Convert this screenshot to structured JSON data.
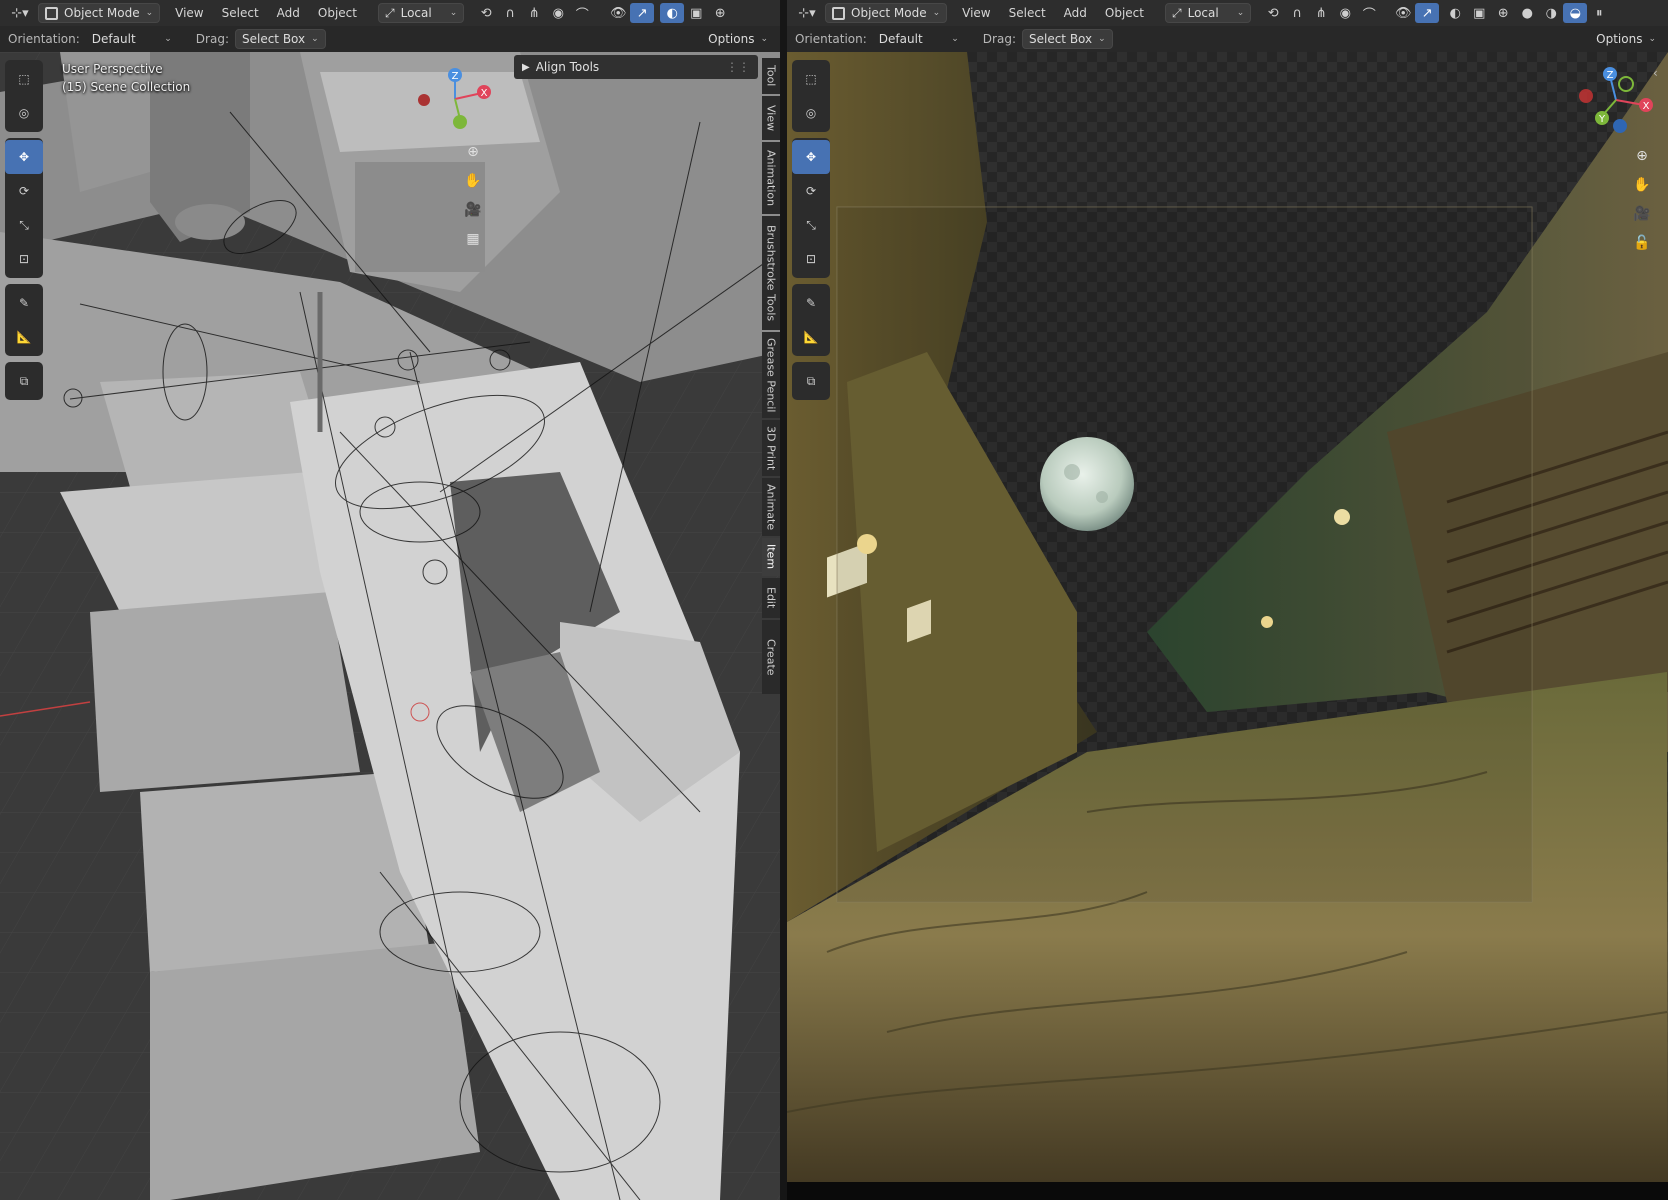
{
  "left": {
    "header": {
      "mode": "Object Mode",
      "menus": [
        "View",
        "Select",
        "Add",
        "Object"
      ],
      "transform_orientation": "Local"
    },
    "tool_header": {
      "orientation_label": "Orientation:",
      "orientation_value": "Default",
      "drag_label": "Drag:",
      "drag_value": "Select Box",
      "options": "Options"
    },
    "overlay": {
      "view_name": "User Perspective",
      "collection": "(15) Scene Collection"
    },
    "align_panel_title": "Align Tools",
    "sidebar_tabs": [
      "Tool",
      "View",
      "Animation",
      "Brushstroke Tools",
      "Grease Pencil",
      "3D Print",
      "Animate",
      "Item",
      "Edit",
      "Create"
    ],
    "active_tab": "Item",
    "gizmo_axes": [
      "Z",
      "X"
    ]
  },
  "right": {
    "header": {
      "mode": "Object Mode",
      "menus": [
        "View",
        "Select",
        "Add",
        "Object"
      ],
      "transform_orientation": "Local"
    },
    "tool_header": {
      "orientation_label": "Orientation:",
      "orientation_value": "Default",
      "drag_label": "Drag:",
      "drag_value": "Select Box",
      "options": "Options"
    },
    "gizmo_axes": [
      "Z",
      "Y",
      "X"
    ]
  },
  "colors": {
    "accent": "#4772b3",
    "header_bg": "#2d2d2d",
    "axis_x": "#e0445a",
    "axis_y": "#7db73a",
    "axis_z": "#4a8fe0"
  },
  "icons": [
    "select-box-icon",
    "cursor-icon",
    "move-icon",
    "rotate-icon",
    "scale-icon",
    "transform-icon",
    "annotate-icon",
    "measure-icon",
    "add-cube-icon",
    "zoom-icon",
    "hand-pan-icon",
    "camera-icon",
    "grid-icon",
    "lock-icon"
  ]
}
